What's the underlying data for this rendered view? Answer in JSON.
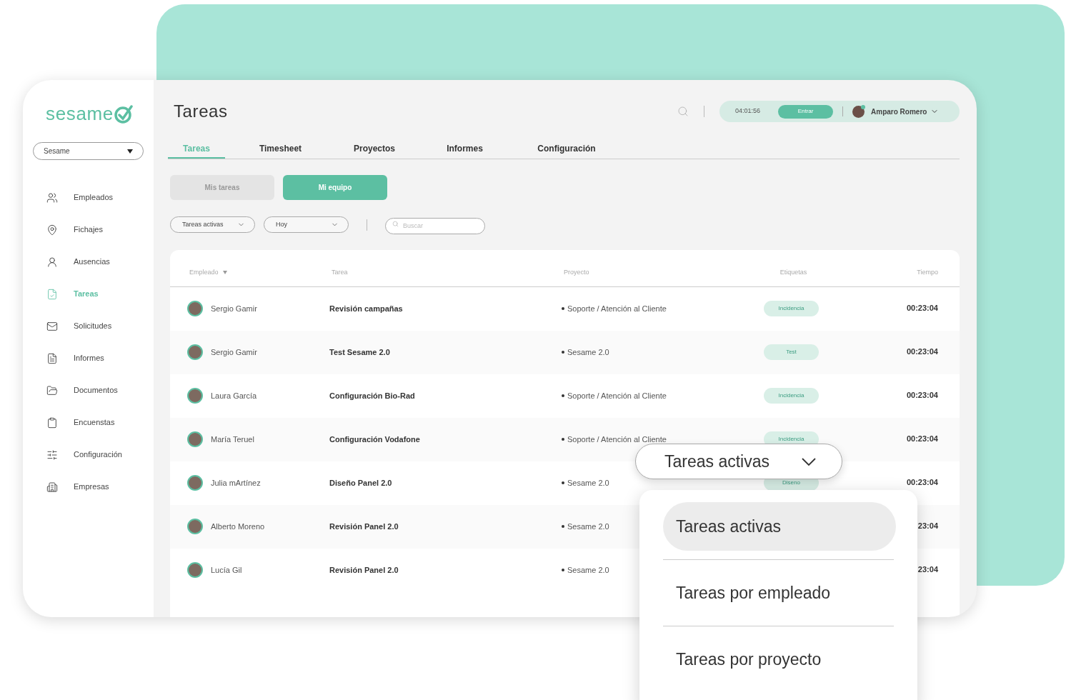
{
  "sidebar": {
    "logo": "sesame",
    "company_select": {
      "value": "Sesame"
    },
    "items": [
      {
        "label": "Empleados",
        "selected": false
      },
      {
        "label": "Fichajes",
        "selected": false
      },
      {
        "label": "Ausencias",
        "selected": false
      },
      {
        "label": "Tareas",
        "selected": true
      },
      {
        "label": "Solicitudes",
        "selected": false
      },
      {
        "label": "Informes",
        "selected": false
      },
      {
        "label": "Documentos",
        "selected": false
      },
      {
        "label": "Encuenstas",
        "selected": false
      },
      {
        "label": "Configuración",
        "selected": false
      },
      {
        "label": "Empresas",
        "selected": false
      }
    ]
  },
  "header": {
    "title": "Tareas",
    "clock": "04:01:56",
    "clock_button": "Entrar",
    "user": "Amparo Romero"
  },
  "tabs": [
    {
      "label": "Tareas",
      "selected": true
    },
    {
      "label": "Timesheet",
      "selected": false
    },
    {
      "label": "Proyectos",
      "selected": false
    },
    {
      "label": "Informes",
      "selected": false
    },
    {
      "label": "Configuración",
      "selected": false
    }
  ],
  "scope": [
    {
      "label": "Mis tareas",
      "selected": false
    },
    {
      "label": "Mi equipo",
      "selected": true
    }
  ],
  "filters": [
    {
      "value": "Tareas activas"
    },
    {
      "value": "Hoy"
    }
  ],
  "search": {
    "placeholder": "Buscar"
  },
  "table": {
    "columns": [
      "Empleado",
      "Tarea",
      "Proyecto",
      "Etiquetas",
      "Tiempo"
    ],
    "rows": [
      {
        "employee": "Sergio Gamir",
        "task": "Revisión campañas",
        "project": "Soporte / Atención al Cliente",
        "tag": "Incidencia",
        "time": "00:23:04"
      },
      {
        "employee": "Sergio Gamir",
        "task": "Test Sesame 2.0",
        "project": "Sesame 2.0",
        "tag": "Test",
        "time": "00:23:04"
      },
      {
        "employee": "Laura García",
        "task": "Configuración Bio-Rad",
        "project": "Soporte / Atención al Cliente",
        "tag": "Incidencia",
        "time": "00:23:04"
      },
      {
        "employee": "María Teruel",
        "task": "Configuración Vodafone",
        "project": "Soporte / Atención al Cliente",
        "tag": "Incidencia",
        "time": "00:23:04"
      },
      {
        "employee": "Julia mArtínez",
        "task": "Diseño Panel 2.0",
        "project": "Sesame 2.0",
        "tag": "Diseno",
        "time": "00:23:04"
      },
      {
        "employee": "Alberto Moreno",
        "task": "Revisión Panel 2.0",
        "project": "Sesame 2.0",
        "time": "23:04"
      },
      {
        "employee": "Lucía Gil",
        "task": "Revisión Panel 2.0",
        "project": "Sesame 2.0",
        "time": "23:04"
      }
    ]
  },
  "dropdown": {
    "value": "Tareas activas",
    "options": [
      {
        "label": "Tareas activas",
        "selected": true
      },
      {
        "label": "Tareas por empleado",
        "selected": false
      },
      {
        "label": "Tareas por proyecto",
        "selected": false
      }
    ]
  }
}
